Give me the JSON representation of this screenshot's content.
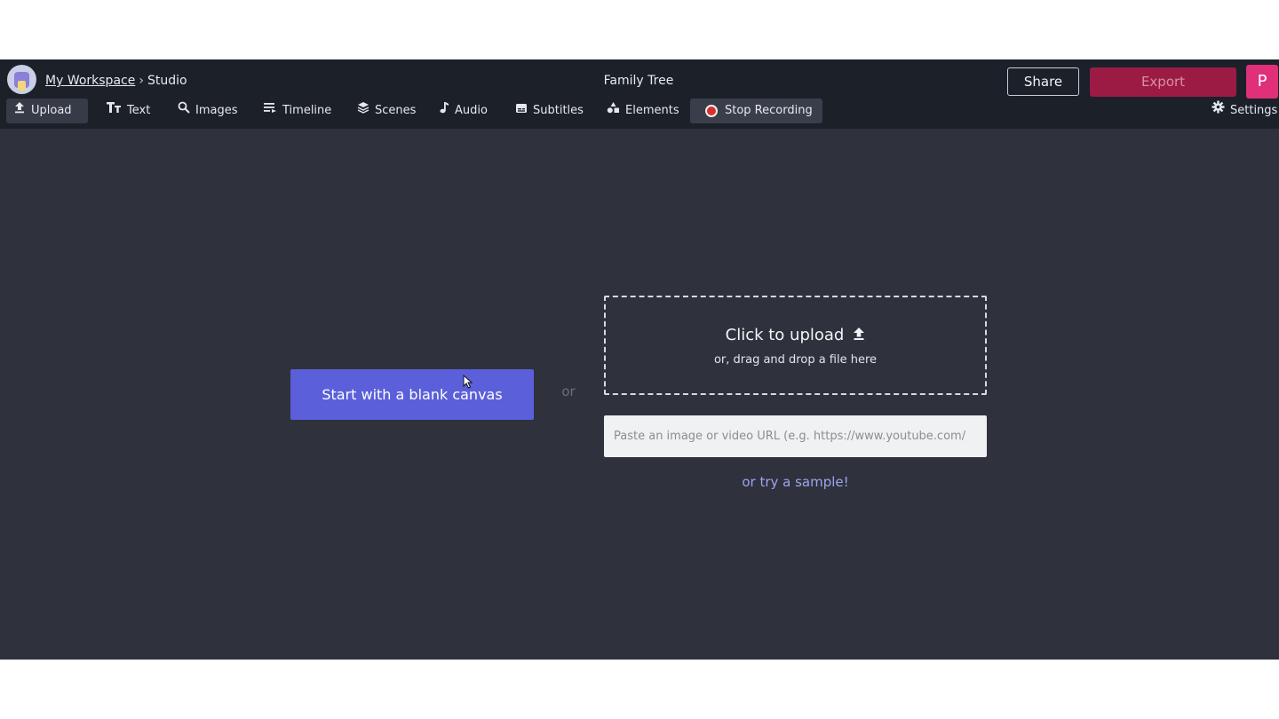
{
  "header": {
    "breadcrumb": {
      "workspace": "My Workspace",
      "separator": "›",
      "current": "Studio"
    },
    "title": "Family Tree",
    "share_label": "Share",
    "export_label": "Export",
    "profile_initial": "P"
  },
  "toolbar": {
    "items": [
      {
        "label": "Upload",
        "icon": "upload-icon",
        "active": true
      },
      {
        "label": "Text",
        "icon": "text-icon"
      },
      {
        "label": "Images",
        "icon": "search-icon"
      },
      {
        "label": "Timeline",
        "icon": "timeline-icon"
      },
      {
        "label": "Scenes",
        "icon": "layers-icon"
      },
      {
        "label": "Audio",
        "icon": "music-note-icon"
      },
      {
        "label": "Subtitles",
        "icon": "subtitles-icon"
      },
      {
        "label": "Elements",
        "icon": "shapes-icon"
      },
      {
        "label": "Stop Recording",
        "icon": "record-icon"
      }
    ],
    "settings_label": "Settings"
  },
  "main": {
    "blank_canvas_label": "Start with a blank canvas",
    "or_label": "or",
    "upload_title": "Click to upload",
    "upload_subtitle": "or, drag and drop a file here",
    "url_placeholder": "Paste an image or video URL (e.g. https://www.youtube.com/",
    "sample_link": "or try a sample!"
  },
  "colors": {
    "topbar": "#1c2029",
    "canvas": "#2f323c",
    "primary_button": "#5b5fd9",
    "export_button": "#9b1b45",
    "profile": "#e0307a"
  }
}
